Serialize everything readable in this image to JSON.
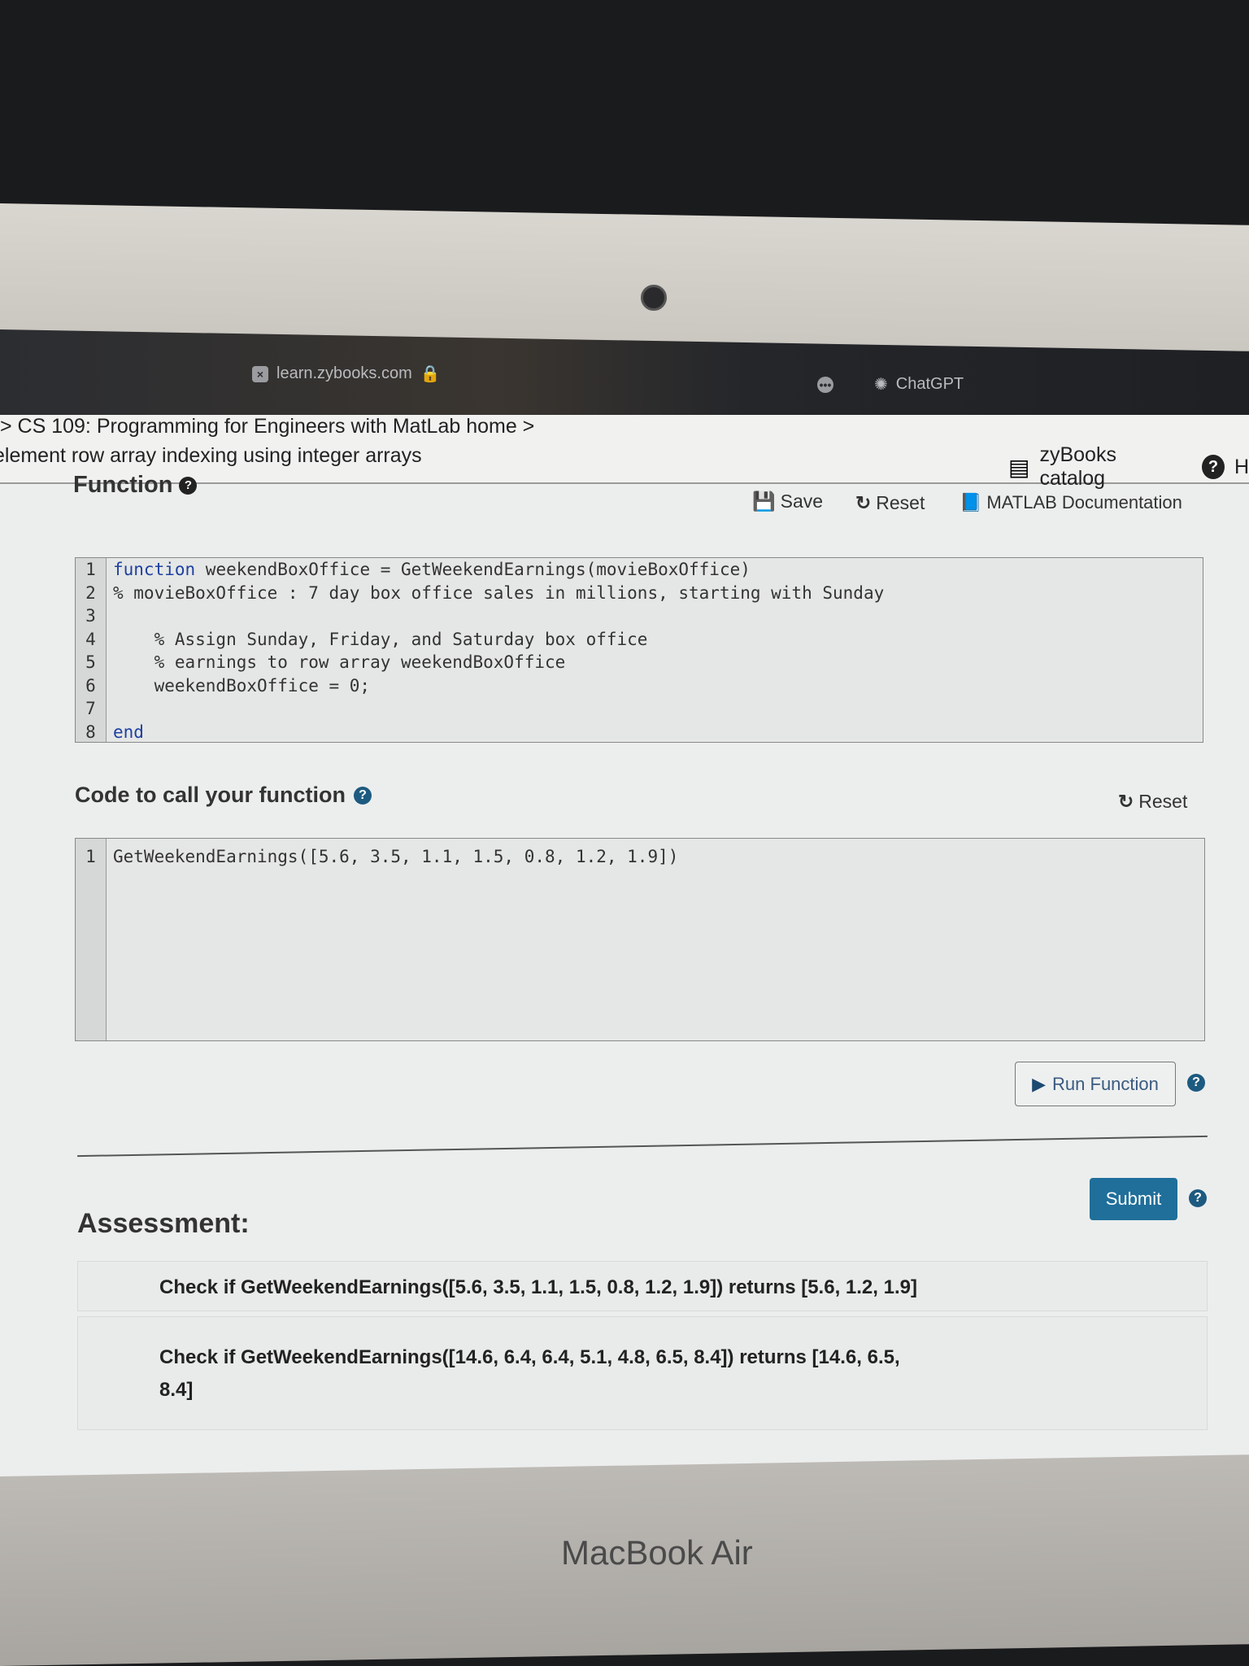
{
  "browser": {
    "url": "learn.zybooks.com",
    "tab2": "ChatGPT"
  },
  "breadcrumb": {
    "line1": "> CS 109: Programming for Engineers with MatLab home >",
    "line2": "element row array indexing using integer arrays"
  },
  "header": {
    "catalog": "zyBooks catalog",
    "help_partial": "H"
  },
  "function_section": {
    "title": "Function",
    "save": "Save",
    "reset": "Reset",
    "docs": "MATLAB Documentation",
    "line_numbers": [
      "1",
      "2",
      "3",
      "4",
      "5",
      "6",
      "7",
      "8"
    ],
    "lines": [
      "function weekendBoxOffice = GetWeekendEarnings(movieBoxOffice)",
      "% movieBoxOffice : 7 day box office sales in millions, starting with Sunday",
      "",
      "    % Assign Sunday, Friday, and Saturday box office",
      "    % earnings to row array weekendBoxOffice",
      "    weekendBoxOffice = 0;",
      "",
      "end"
    ]
  },
  "call_section": {
    "title": "Code to call your function",
    "reset": "Reset",
    "line_numbers": [
      "1"
    ],
    "lines": [
      "GetWeekendEarnings([5.6, 3.5, 1.1, 1.5, 0.8, 1.2, 1.9])"
    ]
  },
  "run_button": "Run Function",
  "submit_button": "Submit",
  "assessment": {
    "title": "Assessment:",
    "checks": [
      "Check if GetWeekendEarnings([5.6, 3.5, 1.1, 1.5, 0.8, 1.2, 1.9]) returns [5.6, 1.2, 1.9]",
      "Check if GetWeekendEarnings([14.6, 6.4, 6.4, 5.1, 4.8, 6.5, 8.4]) returns [14.6, 6.5, 8.4]"
    ]
  },
  "device_label": "MacBook Air",
  "colors": {
    "submit": "#1f6f9a",
    "keyword": "#1e40a0",
    "help_icon": "#1d5a80"
  }
}
